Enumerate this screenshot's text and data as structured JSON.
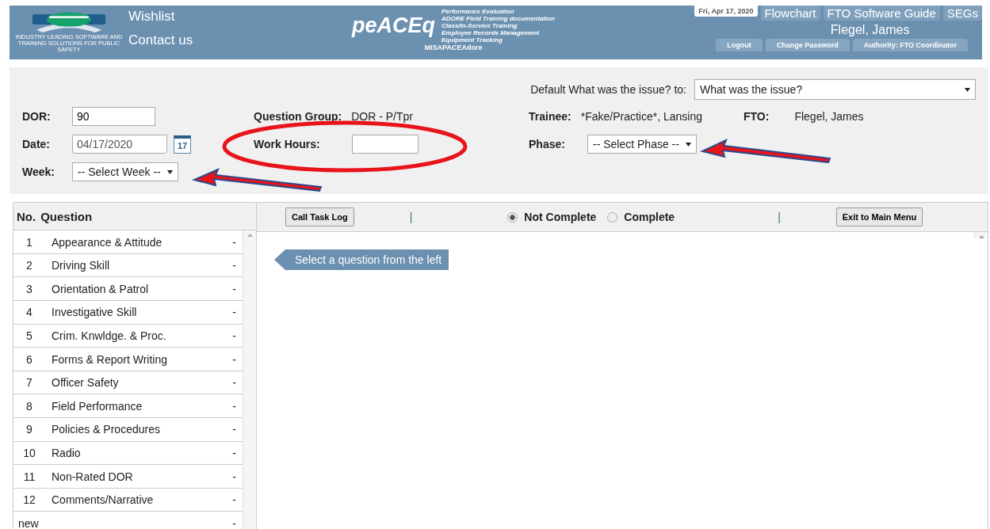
{
  "header": {
    "logo_tagline": "INDUSTRY LEADING SOFTWARE AND TRAINING SOLUTIONS FOR PUBLIC SAFETY",
    "links": [
      "Wishlist",
      "Contact us"
    ],
    "product": "peACEq",
    "product_lines": [
      "Performance Evaluation",
      "ADORE Field Training documentation",
      "Class/In-Service Training",
      "Employee Records Management",
      "Equipment Tracking"
    ],
    "site": "MISAPACEAdore",
    "date": "Fri, Apr 17, 2020",
    "top_tabs": [
      "Flowchart",
      "FTO Software Guide",
      "SEGs"
    ],
    "user": "Flegel, James",
    "bottom_tabs": [
      "Logout",
      "Change Password",
      "Authority: FTO Coordinator"
    ]
  },
  "form": {
    "default_label": "Default What was the issue? to:",
    "default_value": "What was the issue?",
    "dor_label": "DOR:",
    "dor_value": "90",
    "date_label": "Date:",
    "date_value": "04/17/2020",
    "calendar_day": "17",
    "week_label": "Week:",
    "week_value": "-- Select Week --",
    "question_group_label": "Question Group:",
    "question_group_value": "DOR - P/Tpr",
    "work_hours_label": "Work Hours:",
    "trainee_label": "Trainee:",
    "trainee_value": "*Fake/Practice*, Lansing",
    "fto_label": "FTO:",
    "fto_value": "Flegel, James",
    "phase_label": "Phase:",
    "phase_value": "-- Select Phase --"
  },
  "questions": {
    "columns": [
      "No.",
      "Question"
    ],
    "rows": [
      {
        "no": "1",
        "question": "Appearance & Attitude",
        "mark": "-"
      },
      {
        "no": "2",
        "question": "Driving Skill",
        "mark": "-"
      },
      {
        "no": "3",
        "question": "Orientation & Patrol",
        "mark": "-"
      },
      {
        "no": "4",
        "question": "Investigative Skill",
        "mark": "-"
      },
      {
        "no": "5",
        "question": "Crim. Knwldge. & Proc.",
        "mark": "-"
      },
      {
        "no": "6",
        "question": "Forms & Report Writing",
        "mark": "-"
      },
      {
        "no": "7",
        "question": "Officer Safety",
        "mark": "-"
      },
      {
        "no": "8",
        "question": "Field Performance",
        "mark": "-"
      },
      {
        "no": "9",
        "question": "Policies & Procedures",
        "mark": "-"
      },
      {
        "no": "10",
        "question": "Radio",
        "mark": "-"
      },
      {
        "no": "11",
        "question": "Non-Rated DOR",
        "mark": "-"
      },
      {
        "no": "12",
        "question": "Comments/Narrative",
        "mark": "-"
      },
      {
        "no": "new",
        "question": "",
        "mark": "-"
      }
    ]
  },
  "toolbar": {
    "task_log_button": "Call Task Log",
    "separator": "|",
    "status_options": [
      {
        "label": "Not Complete",
        "selected": true
      },
      {
        "label": "Complete",
        "selected": false
      }
    ],
    "separator_2": "|",
    "exit_button": "Exit to Main Menu"
  },
  "hint": "Select a question from the left"
}
